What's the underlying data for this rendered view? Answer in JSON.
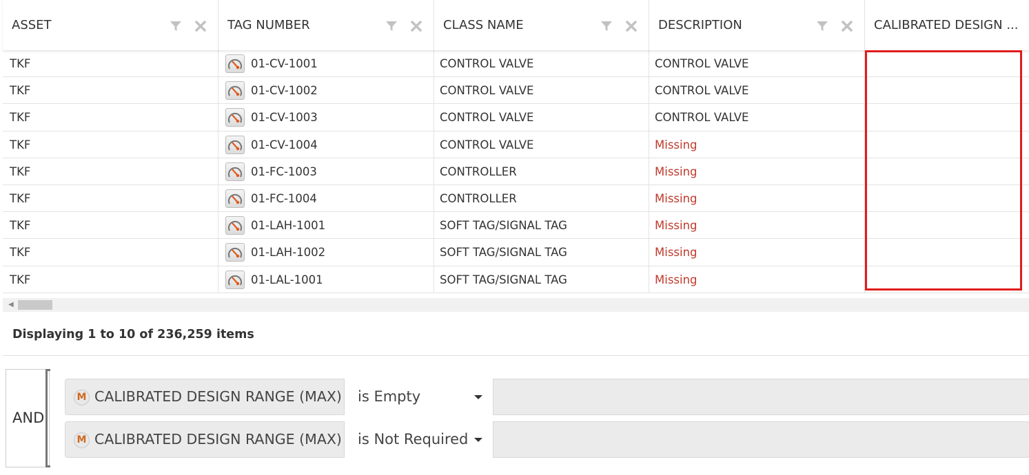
{
  "columns": [
    "ASSET",
    "TAG NUMBER",
    "CLASS NAME",
    "DESCRIPTION",
    "CALIBRATED DESIGN ..."
  ],
  "rows": [
    {
      "asset": "TKF",
      "tag": "01-CV-1001",
      "class": "CONTROL VALVE",
      "description": "CONTROL VALVE",
      "missing": false
    },
    {
      "asset": "TKF",
      "tag": "01-CV-1002",
      "class": "CONTROL VALVE",
      "description": "CONTROL VALVE",
      "missing": false
    },
    {
      "asset": "TKF",
      "tag": "01-CV-1003",
      "class": "CONTROL VALVE",
      "description": "CONTROL VALVE",
      "missing": false
    },
    {
      "asset": "TKF",
      "tag": "01-CV-1004",
      "class": "CONTROL VALVE",
      "description": "Missing",
      "missing": true
    },
    {
      "asset": "TKF",
      "tag": "01-FC-1003",
      "class": "CONTROLLER",
      "description": "Missing",
      "missing": true
    },
    {
      "asset": "TKF",
      "tag": "01-FC-1004",
      "class": "CONTROLLER",
      "description": "Missing",
      "missing": true
    },
    {
      "asset": "TKF",
      "tag": "01-LAH-1001",
      "class": "SOFT TAG/SIGNAL TAG",
      "description": "Missing",
      "missing": true
    },
    {
      "asset": "TKF",
      "tag": "01-LAH-1002",
      "class": "SOFT TAG/SIGNAL TAG",
      "description": "Missing",
      "missing": true
    },
    {
      "asset": "TKF",
      "tag": "01-LAL-1001",
      "class": "SOFT TAG/SIGNAL TAG",
      "description": "Missing",
      "missing": true
    }
  ],
  "footer": {
    "paging": "Displaying 1 to 10 of 236,259 items"
  },
  "filter": {
    "logic": "AND",
    "conditions": [
      {
        "badge": "M",
        "field": "CALIBRATED DESIGN RANGE (MAX)",
        "operator": "is Empty"
      },
      {
        "badge": "M",
        "field": "CALIBRATED DESIGN RANGE (MAX)",
        "operator": "is Not Required"
      }
    ]
  },
  "colors": {
    "missing": "#c0392b",
    "highlight": "#e21b1b",
    "badge": "#d06a1f"
  },
  "icons": {
    "filter": "funnel-icon",
    "clear": "close-icon",
    "tag": "gauge-icon",
    "scroll_left": "arrow-left-icon",
    "dropdown": "caret-down-icon"
  }
}
